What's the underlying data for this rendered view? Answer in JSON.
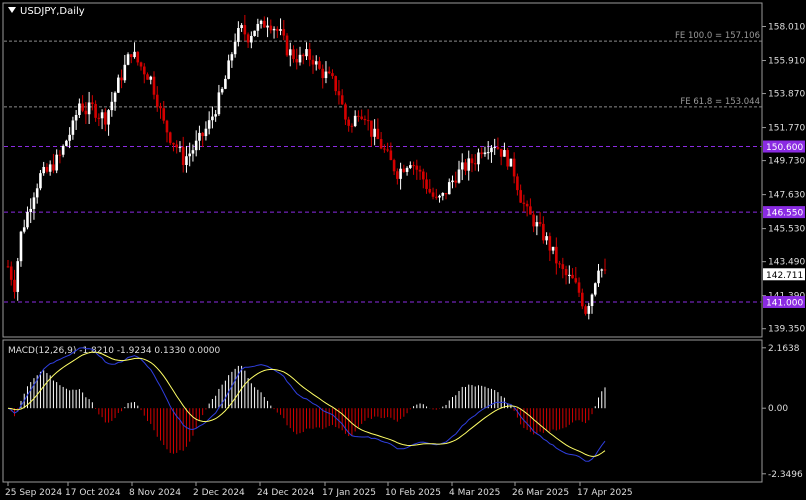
{
  "header": {
    "title": "USDJPY,Daily"
  },
  "chart_data": {
    "type": "candlestick",
    "symbol": "USDJPY",
    "timeframe": "Daily",
    "price_axis": {
      "range": [
        138.9,
        159.4
      ],
      "ticks": [
        "158.010",
        "155.910",
        "153.870",
        "151.770",
        "149.730",
        "147.630",
        "145.530",
        "143.490",
        "141.390",
        "139.350"
      ]
    },
    "x_axis_labels": [
      "25 Sep 2024",
      "17 Oct 2024",
      "8 Nov 2024",
      "2 Dec 2024",
      "24 Dec 2024",
      "17 Jan 2025",
      "10 Feb 2025",
      "4 Mar 2025",
      "26 Mar 2025",
      "17 Apr 2025"
    ],
    "fibonacci_levels": [
      {
        "label": "FE 100.0 = 157.106",
        "price": 157.106
      },
      {
        "label": "FE 61.8 = 153.044",
        "price": 153.044
      }
    ],
    "horizontal_levels": [
      {
        "label": "150.600",
        "price": 150.6,
        "color": "#8a2be2"
      },
      {
        "label": "146.550",
        "price": 146.55,
        "color": "#8a2be2"
      },
      {
        "label": "141.000",
        "price": 141.0,
        "color": "#8a2be2"
      }
    ],
    "current_price": {
      "label": "142.711",
      "price": 142.711
    },
    "price_path": [
      [
        0,
        143.2
      ],
      [
        2,
        142.0
      ],
      [
        4,
        145.2
      ],
      [
        6,
        146.5
      ],
      [
        8,
        147.8
      ],
      [
        10,
        148.8
      ],
      [
        12,
        149.0
      ],
      [
        14,
        149.5
      ],
      [
        16,
        150.0
      ],
      [
        18,
        151.0
      ],
      [
        20,
        151.8
      ],
      [
        22,
        153.3
      ],
      [
        24,
        152.8
      ],
      [
        26,
        153.0
      ],
      [
        28,
        152.6
      ],
      [
        30,
        152.4
      ],
      [
        32,
        153.4
      ],
      [
        34,
        154.5
      ],
      [
        36,
        155.5
      ],
      [
        38,
        156.5
      ],
      [
        40,
        155.8
      ],
      [
        42,
        155.3
      ],
      [
        44,
        154.8
      ],
      [
        46,
        153.5
      ],
      [
        48,
        152.0
      ],
      [
        50,
        151.2
      ],
      [
        52,
        150.6
      ],
      [
        54,
        149.8
      ],
      [
        56,
        150.2
      ],
      [
        58,
        150.7
      ],
      [
        60,
        151.3
      ],
      [
        62,
        152.0
      ],
      [
        64,
        153.0
      ],
      [
        66,
        154.0
      ],
      [
        68,
        155.5
      ],
      [
        70,
        157.3
      ],
      [
        72,
        157.8
      ],
      [
        74,
        157.4
      ],
      [
        76,
        157.9
      ],
      [
        78,
        158.0
      ],
      [
        80,
        158.4
      ],
      [
        82,
        158.0
      ],
      [
        84,
        157.5
      ],
      [
        86,
        156.6
      ],
      [
        88,
        156.2
      ],
      [
        90,
        156.0
      ],
      [
        92,
        156.2
      ],
      [
        94,
        156.0
      ],
      [
        96,
        155.3
      ],
      [
        98,
        155.0
      ],
      [
        100,
        154.6
      ],
      [
        102,
        153.9
      ],
      [
        104,
        152.3
      ],
      [
        106,
        151.8
      ],
      [
        108,
        152.9
      ],
      [
        110,
        152.6
      ],
      [
        112,
        151.5
      ],
      [
        114,
        151.0
      ],
      [
        116,
        150.3
      ],
      [
        118,
        149.6
      ],
      [
        120,
        149.0
      ],
      [
        122,
        149.4
      ],
      [
        124,
        149.8
      ],
      [
        126,
        149.2
      ],
      [
        128,
        148.6
      ],
      [
        130,
        147.8
      ],
      [
        132,
        147.2
      ],
      [
        134,
        147.5
      ],
      [
        136,
        148.2
      ],
      [
        138,
        148.8
      ],
      [
        140,
        149.2
      ],
      [
        142,
        149.5
      ],
      [
        144,
        149.8
      ],
      [
        146,
        150.5
      ],
      [
        148,
        150.7
      ],
      [
        150,
        150.8
      ],
      [
        152,
        150.3
      ],
      [
        154,
        149.8
      ],
      [
        156,
        149.0
      ],
      [
        158,
        147.5
      ],
      [
        160,
        146.5
      ],
      [
        162,
        146.0
      ],
      [
        164,
        145.4
      ],
      [
        166,
        144.8
      ],
      [
        168,
        144.0
      ],
      [
        170,
        143.1
      ],
      [
        172,
        142.6
      ],
      [
        174,
        142.3
      ],
      [
        176,
        141.6
      ],
      [
        178,
        140.5
      ],
      [
        180,
        141.6
      ],
      [
        182,
        143.3
      ],
      [
        184,
        142.7
      ]
    ],
    "macd": {
      "label": "MACD(12,26,9) -1.8210 -1.9234 0.1330 0.0000",
      "params": "12,26,9",
      "main": -1.821,
      "signal": -1.9234,
      "histogram": 0.133,
      "range": [
        -2.5,
        2.3
      ],
      "ticks": [
        "2.1638",
        "0.00",
        "-2.3496"
      ]
    },
    "colors": {
      "bull": "#ffffff",
      "bear": "#d40000",
      "signal": "#ffff66",
      "macd_line": "#2f3fe0",
      "level": "#8a2be2"
    }
  }
}
